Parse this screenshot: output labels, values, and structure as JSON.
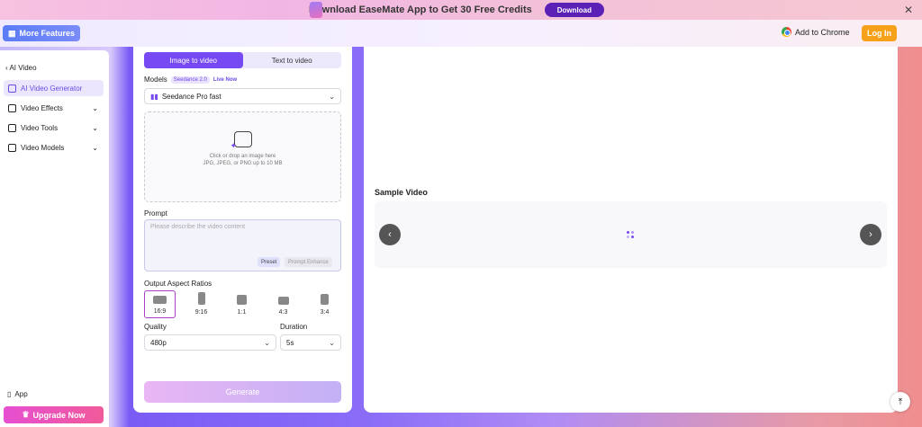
{
  "banner": {
    "text": "Download EaseMate App to Get 30 Free Credits",
    "download_label": "Download"
  },
  "header": {
    "more_features": "More Features",
    "add_to_chrome": "Add to Chrome",
    "login": "Log In"
  },
  "sidebar": {
    "back": "AI Video",
    "items": [
      {
        "label": "AI Video Generator"
      },
      {
        "label": "Video Effects"
      },
      {
        "label": "Video Tools"
      },
      {
        "label": "Video Models"
      }
    ],
    "app": "App",
    "upgrade": "Upgrade Now"
  },
  "form": {
    "tabs": [
      "Image to video",
      "Text to video"
    ],
    "models_label": "Models",
    "badge": "Seedance 2.0",
    "live": "Live Now",
    "model_value": "Seedance Pro fast",
    "drop_line1": "Click or drop an image here",
    "drop_line2": "JPG, JPEG, or PNG up to 10 MB",
    "prompt_label": "Prompt",
    "prompt_placeholder": "Please describe the video content",
    "preset": "Preset",
    "enhance": "Prompt Enhance",
    "aspect_label": "Output Aspect Ratios",
    "ratios": [
      "16:9",
      "9:16",
      "1:1",
      "4:3",
      "3:4"
    ],
    "quality_label": "Quality",
    "quality_value": "480p",
    "duration_label": "Duration",
    "duration_value": "5s",
    "generate": "Generate"
  },
  "main": {
    "sample_title": "Sample Video"
  },
  "colors": {
    "accent": "#7649f2",
    "login": "#f7a11a",
    "upgrade": "#e64fd1"
  }
}
